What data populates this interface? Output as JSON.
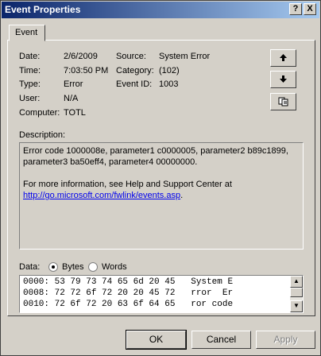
{
  "window": {
    "title": "Event Properties",
    "help_label": "?",
    "close_label": "X"
  },
  "tabs": [
    {
      "label": "Event"
    }
  ],
  "event": {
    "date_label": "Date:",
    "date": "2/6/2009",
    "time_label": "Time:",
    "time": "7:03:50 PM",
    "type_label": "Type:",
    "type": "Error",
    "user_label": "User:",
    "user": "N/A",
    "computer_label": "Computer:",
    "computer": "TOTL",
    "source_label": "Source:",
    "source": "System Error",
    "category_label": "Category:",
    "category": "(102)",
    "event_id_label": "Event ID:",
    "event_id": "1003"
  },
  "side_buttons": {
    "up_icon": "arrow-up-icon",
    "down_icon": "arrow-down-icon",
    "copy_icon": "copy-icon"
  },
  "description": {
    "label": "Description:",
    "text": "Error code 1000008e, parameter1 c0000005, parameter2 b89c1899, parameter3 ba50eff4, parameter4 00000000.",
    "more_info": "For more information, see Help and Support Center at",
    "link": "http://go.microsoft.com/fwlink/events.asp",
    "link_suffix": "."
  },
  "data": {
    "label": "Data:",
    "bytes_label": "Bytes",
    "words_label": "Words",
    "selected": "Bytes",
    "lines": [
      "0000: 53 79 73 74 65 6d 20 45   System E",
      "0008: 72 72 6f 72 20 20 45 72   rror  Er",
      "0010: 72 6f 72 20 63 6f 64 65   ror code"
    ]
  },
  "buttons": {
    "ok": "OK",
    "cancel": "Cancel",
    "apply": "Apply"
  }
}
